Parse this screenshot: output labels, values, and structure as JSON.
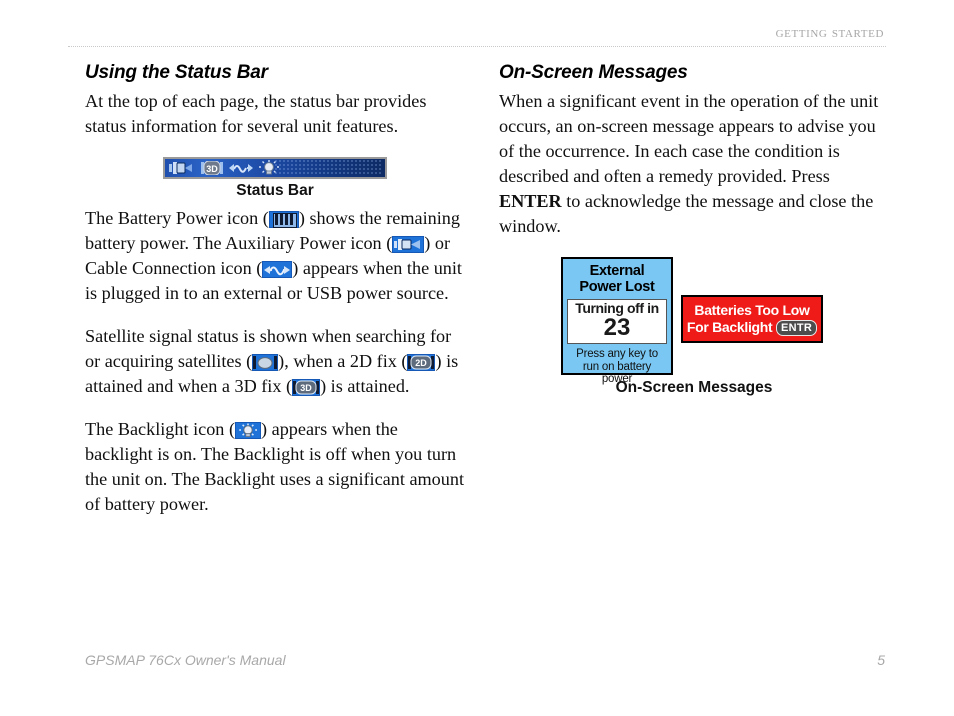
{
  "header": {
    "running_head": "Getting Started"
  },
  "left_column": {
    "section_title": "Using the Status Bar",
    "intro_paragraph": "At the top of each page, the status bar provides status information for several unit features.",
    "figure": {
      "caption": "Status Bar",
      "icons": [
        "auxiliary-power-icon",
        "3d-fix-icon",
        "cable-connection-icon",
        "backlight-icon"
      ]
    },
    "battery_paragraph": {
      "part1": "The Battery Power icon (",
      "part2": ") shows the remaining battery power. The Auxiliary Power icon (",
      "part3": ") or Cable Connection icon (",
      "part4": ") appears when the unit is plugged in to an external or USB power source."
    },
    "satellite_paragraph": {
      "part1": "Satellite signal status is shown when searching for or acquiring satellites (",
      "part2": "), when a 2D fix (",
      "part3": ") is attained and when a 3D fix (",
      "part4": ") is attained."
    },
    "backlight_paragraph": {
      "part1": "The Backlight icon (",
      "part2": ") appears when the backlight is on. The Backlight is off when you turn the unit on. The Backlight uses a significant amount of battery power."
    }
  },
  "right_column": {
    "section_title": "On-Screen Messages",
    "paragraph": {
      "part1": "When a significant event in the operation of the unit occurs, an on-screen message appears to advise you of the occurrence. In each case the condition is described and often a remedy provided. Press ",
      "bold": "ENTER",
      "part2": " to acknowledge the message and close the window."
    },
    "external_power_message": {
      "title_line1": "External",
      "title_line2": "Power Lost",
      "inner_line": "Turning off in",
      "countdown": "23",
      "footer_line1": "Press any key to",
      "footer_line2": "run on battery",
      "footer_line3": "power"
    },
    "battery_low_message": {
      "line1": "Batteries Too Low",
      "line2": "For Backlight",
      "key_label": "ENTR"
    },
    "figure_caption": "On-Screen Messages"
  },
  "footer": {
    "manual_title": "GPSMAP 76Cx Owner's Manual",
    "page_number": "5"
  },
  "colors": {
    "header_gray": "#a6a6a6",
    "status_bar_blue": "#1f4fae",
    "message_blue": "#79c7f2",
    "alert_red": "#ee1b18",
    "icon_blue": "#1f73d8"
  }
}
